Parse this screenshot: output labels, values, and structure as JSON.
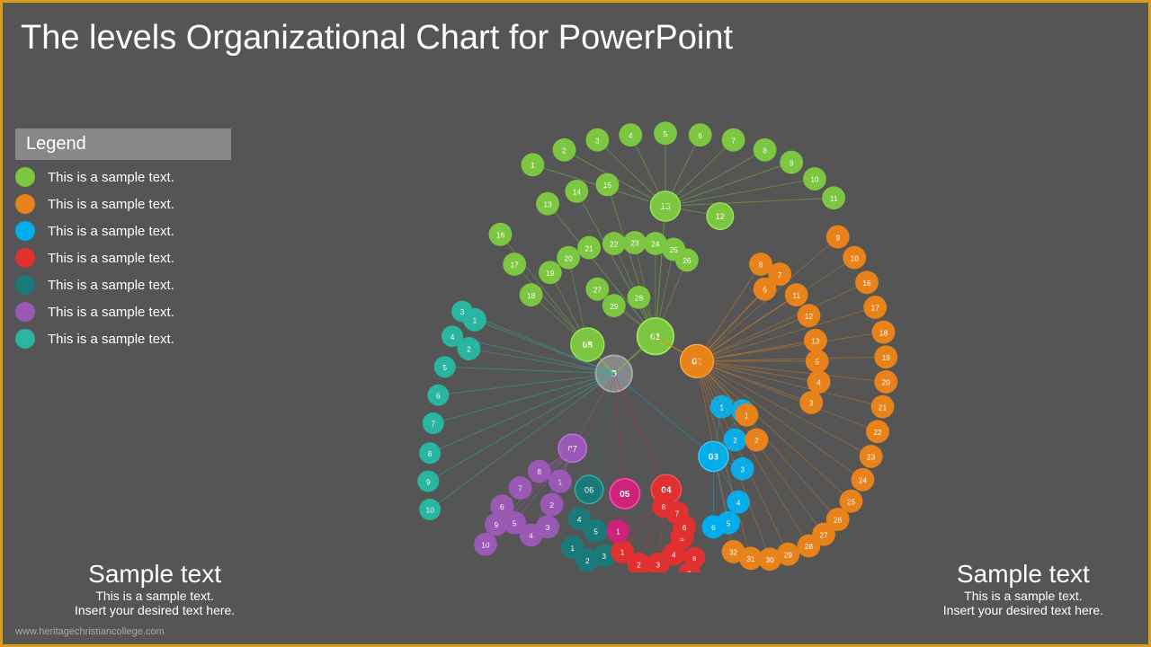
{
  "title": "The levels Organizational Chart for PowerPoint",
  "legend": {
    "header": "Legend",
    "items": [
      {
        "color": "green",
        "label": "This is a sample text."
      },
      {
        "color": "orange",
        "label": "This is a sample text."
      },
      {
        "color": "cyan",
        "label": "This is a sample text."
      },
      {
        "color": "red",
        "label": "This is a sample text."
      },
      {
        "color": "teal",
        "label": "This is a sample text."
      },
      {
        "color": "purple",
        "label": "This is a sample text."
      },
      {
        "color": "teal2",
        "label": "This is a sample text."
      }
    ]
  },
  "sample_left": {
    "heading": "Sample text",
    "line1": "This is a sample text.",
    "line2": "Insert your desired text here."
  },
  "sample_right": {
    "heading": "Sample text",
    "line1": "This is a sample text.",
    "line2": "Insert your desired text here."
  },
  "website": "www.heritagechristiancollege.com"
}
